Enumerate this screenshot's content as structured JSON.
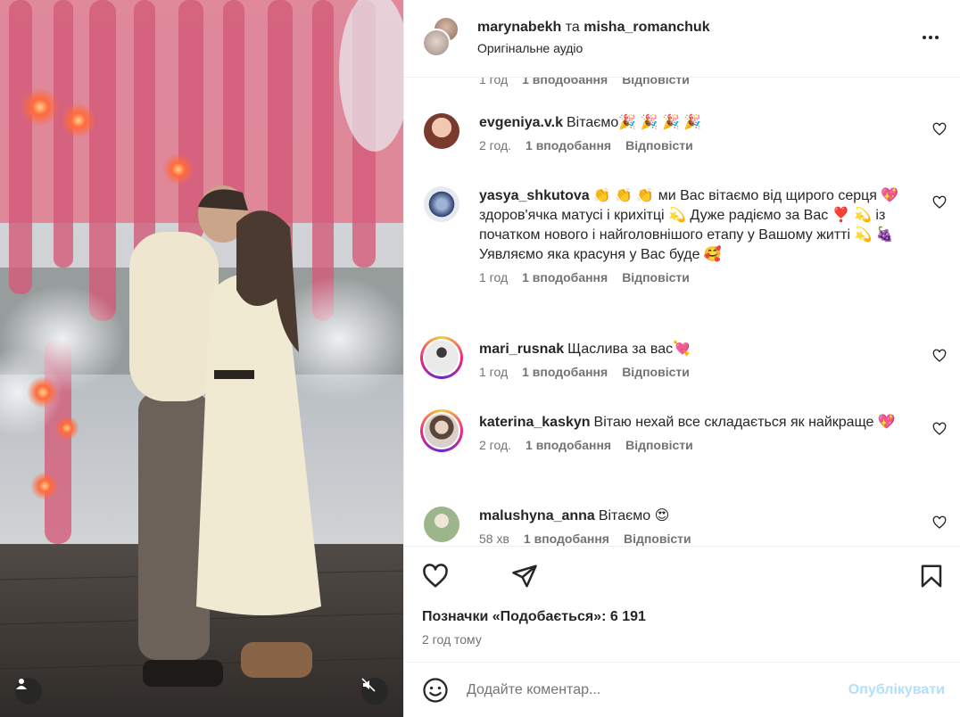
{
  "header": {
    "user1": "marynabekh",
    "separator": "та",
    "user2": "misha_romanchuk",
    "audio": "Оригінальне аудіо"
  },
  "partial_comment": {
    "time": "1 год",
    "likes": "1 вподобання",
    "reply": "Відповісти"
  },
  "comments": [
    {
      "user": "evgeniya.v.k",
      "text": "Вітаємо🎉 🎉 🎉 🎉",
      "time": "2 год.",
      "likes": "1 вподобання",
      "reply": "Відповісти",
      "avatar_color": "#7a3b2e"
    },
    {
      "user": "yasya_shkutova",
      "text": "👏 👏 👏 ми Вас вітаємо від щирого серця 💖 здоров'ячка матусі і крихітці 💫 Дуже радіємо за Вас ❣️ 💫 із початком нового і найголовнішого етапу у Вашому житті 💫 🍇",
      "text2": "Уявляємо яка красуня у Вас буде 🥰",
      "time": "1 год",
      "likes": "1 вподобання",
      "reply": "Відповісти",
      "avatar_color": "#2b3f6b"
    },
    {
      "user": "mari_rusnak",
      "text": "Щаслива за вас💘",
      "time": "1 год",
      "likes": "1 вподобання",
      "reply": "Відповісти",
      "avatar_color": "#d6d6d6"
    },
    {
      "user": "katerina_kaskyn",
      "text": "Вітаю нехай все складається як найкраще 💖",
      "time": "2 год.",
      "likes": "1 вподобання",
      "reply": "Відповісти",
      "avatar_color": "#c8b9ae"
    },
    {
      "user": "malushyna_anna",
      "text": "Вітаємо 😍",
      "time": "58 хв",
      "likes": "1 вподобання",
      "reply": "Відповісти",
      "avatar_color": "#9cb58a"
    }
  ],
  "actions": {
    "like_icon": "heart-outline",
    "comment_icon": "speech-bubble",
    "share_icon": "paper-plane",
    "save_icon": "bookmark"
  },
  "likes_text": "Позначки «Подобається»: 6 191",
  "post_time": "2 год тому",
  "composer": {
    "placeholder": "Додайте коментар...",
    "publish_label": "Опублікувати",
    "publish_color": "#b2dffc"
  },
  "colors": {
    "text": "#262626",
    "secondary": "#737373",
    "divider": "#efefef"
  }
}
